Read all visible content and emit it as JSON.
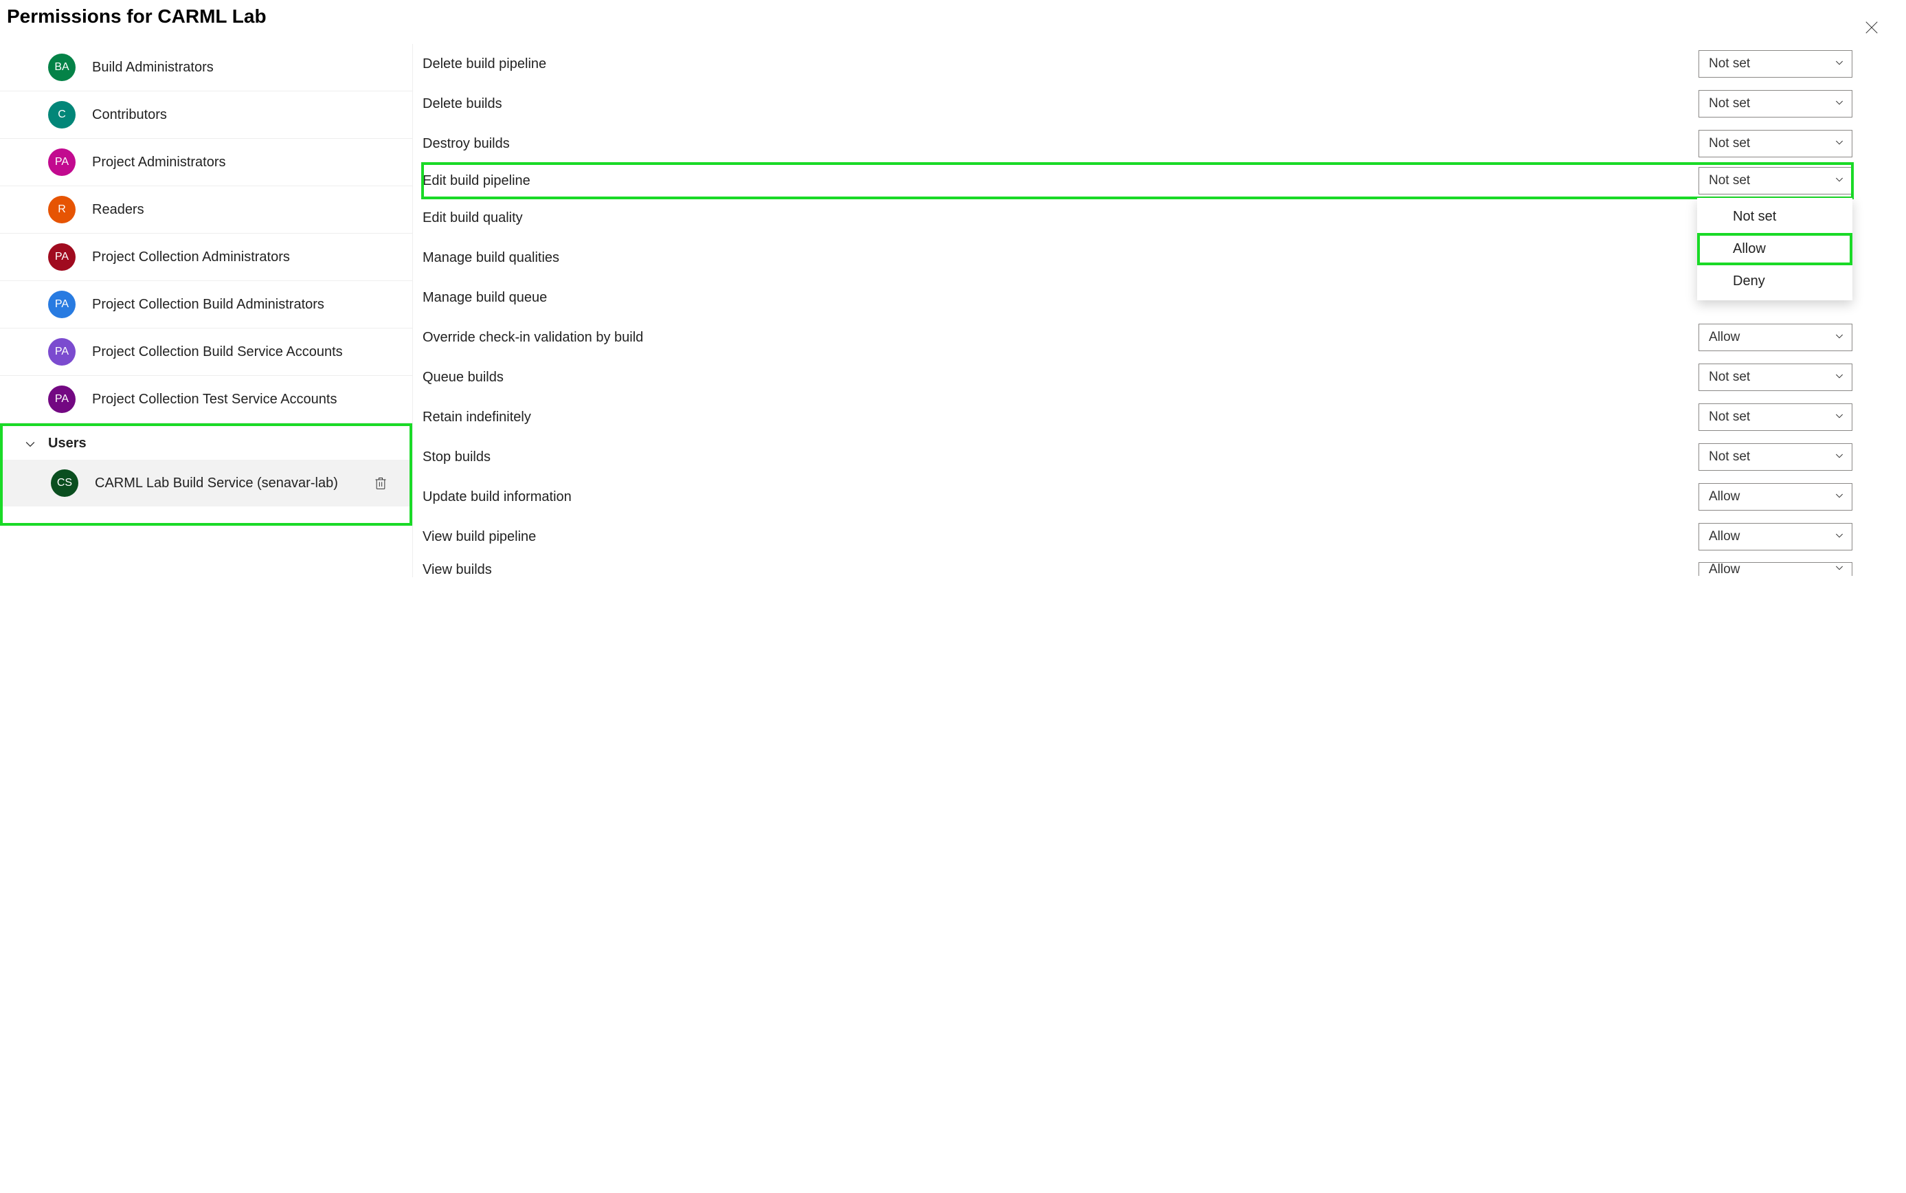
{
  "title": "Permissions for CARML Lab",
  "groups": [
    {
      "initials": "BA",
      "name": "Build Administrators",
      "color": "#048247"
    },
    {
      "initials": "C",
      "name": "Contributors",
      "color": "#028678"
    },
    {
      "initials": "PA",
      "name": "Project Administrators",
      "color": "#c20a8f"
    },
    {
      "initials": "R",
      "name": "Readers",
      "color": "#e65403"
    },
    {
      "initials": "PA",
      "name": "Project Collection Administrators",
      "color": "#a00b1f"
    },
    {
      "initials": "PA",
      "name": "Project Collection Build Administrators",
      "color": "#287be1"
    },
    {
      "initials": "PA",
      "name": "Project Collection Build Service Accounts",
      "color": "#7b4bcf"
    },
    {
      "initials": "PA",
      "name": "Project Collection Test Service Accounts",
      "color": "#730882"
    }
  ],
  "usersSection": {
    "label": "Users",
    "users": [
      {
        "initials": "CS",
        "name": "CARML Lab Build Service (senavar-lab)",
        "color": "#0a4e1f"
      }
    ]
  },
  "permissions": [
    {
      "label": "Delete build pipeline",
      "value": "Not set"
    },
    {
      "label": "Delete builds",
      "value": "Not set"
    },
    {
      "label": "Destroy builds",
      "value": "Not set"
    },
    {
      "label": "Edit build pipeline",
      "value": "Not set",
      "highlighted": true,
      "open": true
    },
    {
      "label": "Edit build quality",
      "value": ""
    },
    {
      "label": "Manage build qualities",
      "value": ""
    },
    {
      "label": "Manage build queue",
      "value": ""
    },
    {
      "label": "Override check-in validation by build",
      "value": "Allow"
    },
    {
      "label": "Queue builds",
      "value": "Not set"
    },
    {
      "label": "Retain indefinitely",
      "value": "Not set"
    },
    {
      "label": "Stop builds",
      "value": "Not set"
    },
    {
      "label": "Update build information",
      "value": "Allow"
    },
    {
      "label": "View build pipeline",
      "value": "Allow"
    },
    {
      "label": "View builds",
      "value": "Allow"
    }
  ],
  "dropdownOptions": [
    {
      "label": "Not set"
    },
    {
      "label": "Allow",
      "highlighted": true
    },
    {
      "label": "Deny"
    }
  ]
}
